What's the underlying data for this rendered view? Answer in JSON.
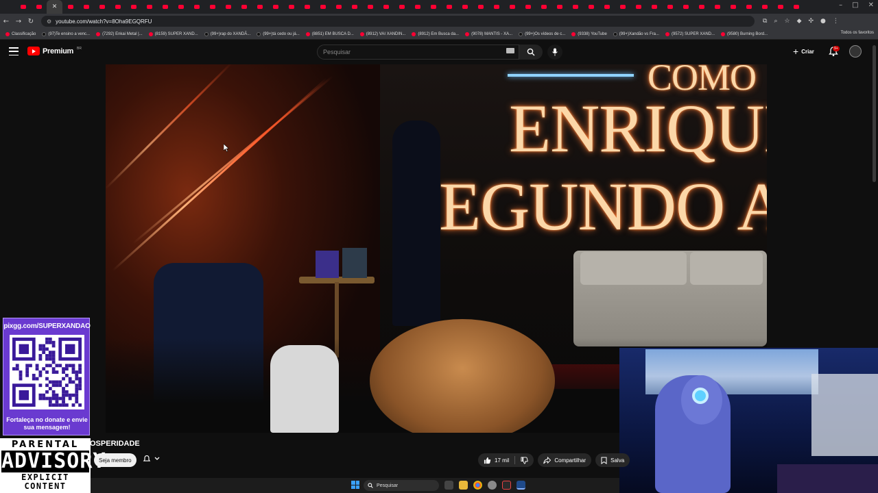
{
  "browser": {
    "url": "youtube.com/watch?v=8Oha9EGQRFU",
    "bookmarks": [
      {
        "label": "Classificação",
        "icon": "bookmark-icon"
      },
      {
        "label": "(97)Te ensino a venc...",
        "icon": "tiktok-icon"
      },
      {
        "label": "(7292) Enkai Metal |...",
        "icon": "youtube-icon"
      },
      {
        "label": "(8159) SUPER XAND...",
        "icon": "youtube-icon"
      },
      {
        "label": "(99+)rap do XANDÃ...",
        "icon": "tiktok-icon"
      },
      {
        "label": "(99+)tá cedo ou já...",
        "icon": "tiktok-icon"
      },
      {
        "label": "(8851) EM BUSCA D...",
        "icon": "youtube-icon"
      },
      {
        "label": "(8912) VAI XANDIN...",
        "icon": "youtube-icon"
      },
      {
        "label": "(8912) Em Busca da...",
        "icon": "youtube-icon"
      },
      {
        "label": "(9078) MANTIS - XA...",
        "icon": "youtube-icon"
      },
      {
        "label": "(99+)Os vídeos de c...",
        "icon": "tiktok-icon"
      },
      {
        "label": "(9338) YouTube",
        "icon": "youtube-icon"
      },
      {
        "label": "(99+)Xandão vs Fra...",
        "icon": "tiktok-icon"
      },
      {
        "label": "(9572) SUPER XAND...",
        "icon": "youtube-icon"
      },
      {
        "label": "(9580) Burning Bord...",
        "icon": "youtube-icon"
      }
    ],
    "all_bookmarks": "Todos os favoritos"
  },
  "youtube": {
    "logo": "Premium",
    "logo_region": "BR",
    "search_placeholder": "Pesquisar",
    "create_label": "Criar",
    "notifications_badge": "9+"
  },
  "video": {
    "frame_text": [
      "COMO",
      "ENRIQUE",
      "EGUNDO A"
    ],
    "title_fragment": "OSPERIDADE",
    "member_button": "Seja membro",
    "likes": "17 mil",
    "share_label": "Compartilhar",
    "save_label": "Salva"
  },
  "overlay": {
    "url": "pixgg.com/SUPERXANDAO",
    "message": "Fortaleça no donate e envie sua mensagem!",
    "advisory": [
      "PARENTAL",
      "ADVISORY",
      "EXPLICIT CONTENT"
    ]
  },
  "taskbar": {
    "search_label": "Pesquisar"
  },
  "colors": {
    "yt_red": "#ff0000",
    "accent_blue": "#3aa0ff",
    "qr_card": "#6a3ad0"
  }
}
